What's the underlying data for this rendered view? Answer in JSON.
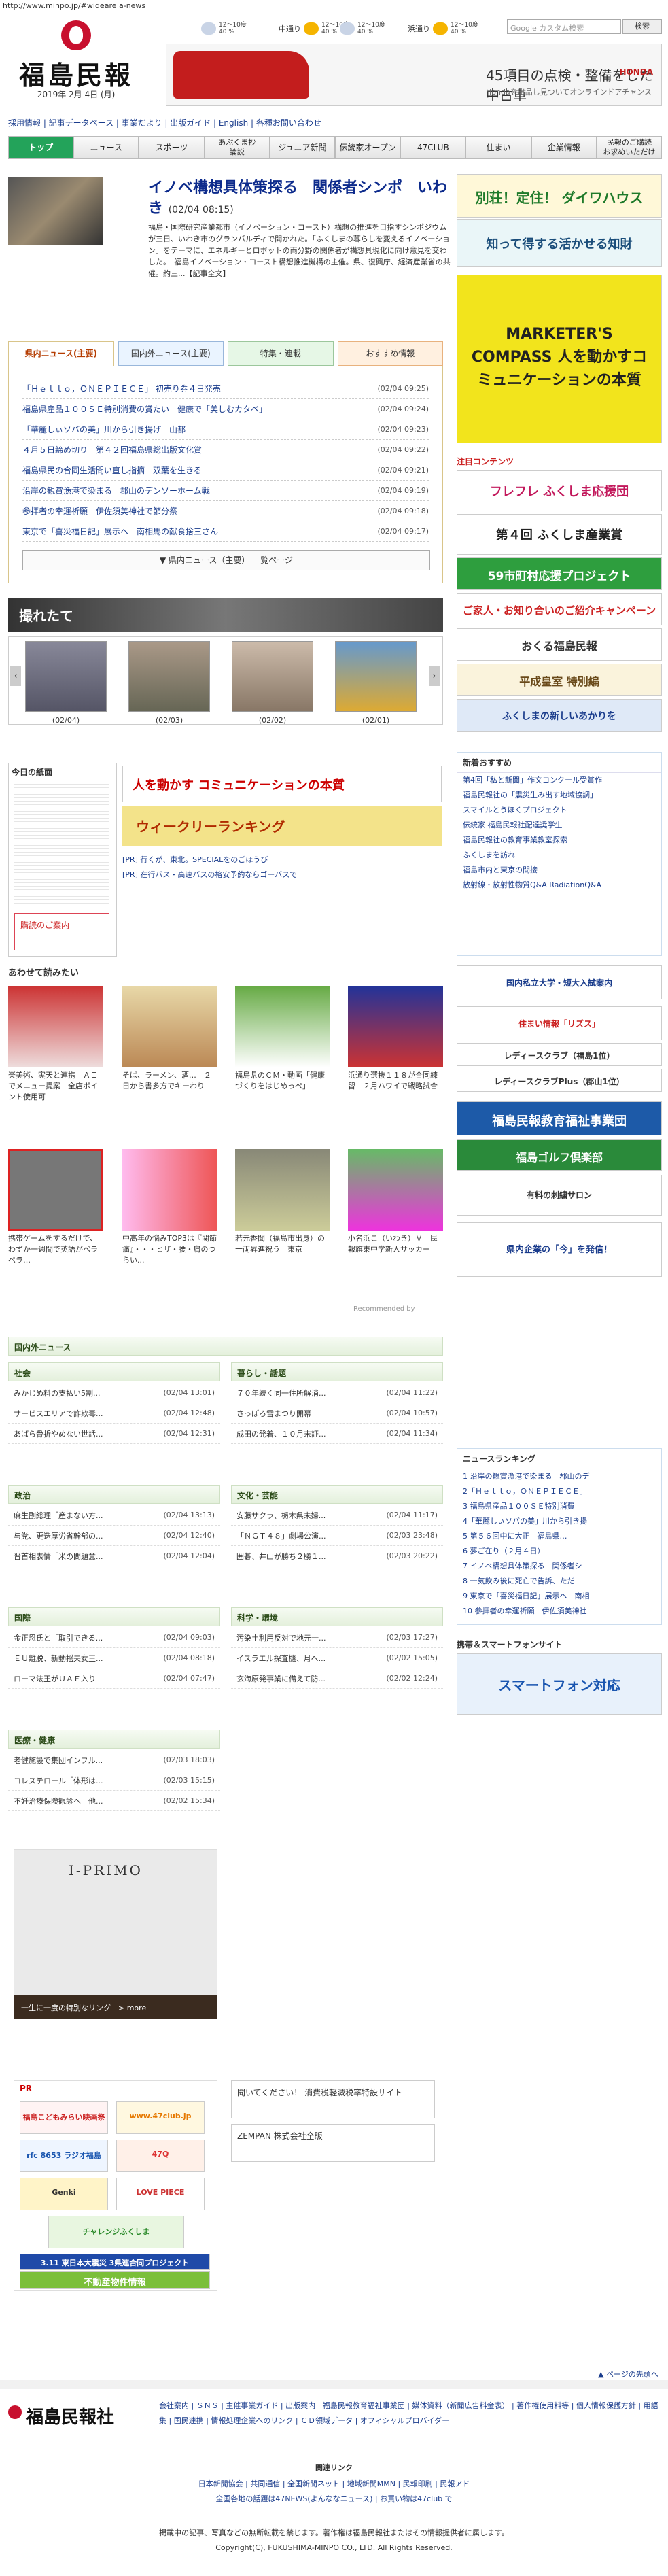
{
  "url": "http://www.minpo.jp/#wideare a-news",
  "logo": {
    "name": "福島民報",
    "date": "2019年 2月 4日 (月)"
  },
  "weather": [
    {
      "area": "",
      "temp": "12〜10度",
      "pct": "40 %"
    },
    {
      "area": "中通り",
      "temp": "12〜10度",
      "pct": "40 %"
    },
    {
      "area": "",
      "temp": "12〜10度",
      "pct": "40 %"
    },
    {
      "area": "浜通り",
      "temp": "12〜10度",
      "pct": "40 %"
    }
  ],
  "search": {
    "placeholder": "Google カスタム検索",
    "button": "検索"
  },
  "car_ad": {
    "headline": "45項目の点検・整備をした中古車",
    "sub": "Hondaを出品し見ついてオンラインドアチャンス",
    "brand": "HONDA"
  },
  "top_links": "採用情報 | 記事データベース | 事業だより | 出版ガイド | English | 各種お問い合わせ",
  "nav": [
    "トップ",
    "ニュース",
    "スポーツ",
    "あぶくま抄\n論説",
    "ジュニア新聞",
    "伝統家オープン",
    "47CLUB",
    "住まい",
    "企業情報",
    "民報のご購読\nお求めいただけ"
  ],
  "headline": {
    "title": "イノベ構想具体策探る　関係者シンポ　いわき",
    "date": "(02/04 08:15)",
    "body": "福島・国際研究産業都市（イノベーション・コースト）構想の推進を目指すシンポジウムが三日、いわき市のグランパルディで開かれた。「ふくしまの暮らしを変えるイノベーション」をテーマに、エネルギーとロボットの両分野の関係者が構想具現化に向け意見を交わした。　福島イノベーション・コースト構想推進機構の主催。県、復興庁、経済産業省の共催。約三...【記事全文】"
  },
  "tabs": [
    "県内ニュース(主要)",
    "国内外ニュース(主要)",
    "特集・連載",
    "おすすめ情報"
  ],
  "prefecture_news": [
    {
      "title": "「Ｈｅｌｌｏ，ＯＮＥＰＩＥＣＥ」 初売り券４日発売",
      "date": "(02/04 09:25)"
    },
    {
      "title": "福島県産品１００ＳＥ特別消費の賞たい　健康で「美しむカタベ」",
      "date": "(02/04 09:24)"
    },
    {
      "title": "「華麗しぃソバの美」川から引き揚げ　山都",
      "date": "(02/04 09:23)"
    },
    {
      "title": "４月５日締め切り　第４２回福島県総出版文化賞",
      "date": "(02/04 09:22)"
    },
    {
      "title": "福島県民の合同生活問い直し指摘　双葉を生きる",
      "date": "(02/04 09:21)"
    },
    {
      "title": "沿岸の観賞漁港で染まる　郡山のデンソーホーム戦",
      "date": "(02/04 09:19)"
    },
    {
      "title": "参拝者の幸運祈願　伊佐須美神社で節分祭",
      "date": "(02/04 09:18)"
    },
    {
      "title": "東京で「喜災福日記」展示へ　南相馬の献食捨三さん",
      "date": "(02/04 09:17)"
    }
  ],
  "more_label": "▼ 県内ニュース（主要） 一覧ページ",
  "photo": {
    "title": "撮れたて",
    "captions": [
      "(02/04)",
      "(02/03)",
      "(02/02)",
      "(02/01)"
    ]
  },
  "today_paper": {
    "title": "今日の紙面",
    "buy": "購読のご案内"
  },
  "mc_ad": "人を動かす コミュニケーションの本質",
  "rank_ad": "ウィークリーランキング",
  "pr_links": [
    "[PR] 行くが、東北。SPECIALをのごほうび",
    "[PR] 在行バス・高速バスの格安予約ならゴーバスで"
  ],
  "recommend_title": "あわせて読みたい",
  "recommend": [
    "楽美術、実天と連携　ＡＩでメニュー提案　全店ポイント使用可",
    "そば、ラーメン、酒…　２日から書多方でキーわり",
    "福島県のＣＭ・動画「健康づくりをはじめっぺ」",
    "浜通り選抜１１８が合同練習　２月ハワイで戦略試合",
    "携帯ゲームをするだけで、わずか一週間で英語がペラペラ…",
    "中高年の悩みTOP3は『関節痛』・・・ヒザ・腰・肩のつらい...",
    "若元香聞（福島市出身）の十両昇進祝う　東京",
    "小名浜こ（いわき）Ｖ　民報旗東中学新人サッカー"
  ],
  "recommend_by": "Recommended by",
  "domestic_head": "国内外ニュース",
  "sections": [
    {
      "name": "社会",
      "rows": [
        {
          "t": "みかじめ料の支払い5割...",
          "d": "(02/04 13:01)"
        },
        {
          "t": "サービスエリアで詐欺毒...",
          "d": "(02/04 12:48)"
        },
        {
          "t": "あばら骨折やめない世話...",
          "d": "(02/04 12:31)"
        }
      ]
    },
    {
      "name": "暮らし・話題",
      "rows": [
        {
          "t": "７０年続く同一住所解消...",
          "d": "(02/04 11:22)"
        },
        {
          "t": "さっぽろ雪まつり開幕",
          "d": "(02/04 10:57)"
        },
        {
          "t": "成田の発着、１０月末証...",
          "d": "(02/04 11:34)"
        }
      ]
    },
    {
      "name": "政治",
      "rows": [
        {
          "t": "麻生副総理「産まない方...",
          "d": "(02/04 13:13)"
        },
        {
          "t": "与党、更迭厚労省幹部の...",
          "d": "(02/04 12:40)"
        },
        {
          "t": "晋首相表情「米の問題意...",
          "d": "(02/04 12:04)"
        }
      ]
    },
    {
      "name": "文化・芸能",
      "rows": [
        {
          "t": "安藤サクラ、栃木県未婦...",
          "d": "(02/04 11:17)"
        },
        {
          "t": "「ＮＧＴ４８」劇場公演...",
          "d": "(02/03 23:48)"
        },
        {
          "t": "囲碁、井山が勝ち２勝１...",
          "d": "(02/03 20:22)"
        }
      ]
    },
    {
      "name": "国際",
      "rows": [
        {
          "t": "金正恩氏と「取引できる...",
          "d": "(02/04 09:03)"
        },
        {
          "t": "ＥＵ離脱、新動揺夫女王...",
          "d": "(02/04 08:18)"
        },
        {
          "t": "ローマ法王がＵＡＥ入り",
          "d": "(02/04 07:47)"
        }
      ]
    },
    {
      "name": "科学・環境",
      "rows": [
        {
          "t": "汚染土利用反対で地元一...",
          "d": "(02/03 17:27)"
        },
        {
          "t": "イスラエル探査機、月へ...",
          "d": "(02/02 15:05)"
        },
        {
          "t": "玄海原発事業に備えて防...",
          "d": "(02/02 12:24)"
        }
      ]
    },
    {
      "name": "医療・健康",
      "rows": [
        {
          "t": "老健施設で集団インフル...",
          "d": "(02/03 18:03)"
        },
        {
          "t": "コレステロール「体形は...",
          "d": "(02/03 15:15)"
        },
        {
          "t": "不妊治療保険観診へ　他...",
          "d": "(02/02 15:34)"
        }
      ]
    }
  ],
  "iprimo": {
    "brand": "I-PRIMO",
    "tagline": "一生に一度の特別なリング　> more"
  },
  "pr_box": {
    "title": "PR",
    "items": [
      "福島こどもみらい映画祭",
      "www.47club.jp",
      "rfc 8653 ラジオ福島",
      "47Q",
      "Genki",
      "LOVE PIECE",
      "チャレンジふくしま",
      "3.11 東日本大震災 3県連合同プロジェクト",
      "不動産物件情報"
    ]
  },
  "side_banners": [
    {
      "t": "聞いてください！ 消費税軽減税率特設サイト"
    },
    {
      "t": "ZEMPAN 株式会社全販"
    }
  ],
  "right": {
    "ad1": "別荘！定住！ ダイワハウス",
    "ad1b": "知って得する活かせる知財",
    "ad2": "MARKETER'S COMPASS 人を動かすコミュニケーションの本質",
    "contents_head": "注目コンテンツ",
    "banners": [
      "フレフレ ふくしま応援団",
      "第４回 ふくしま産業賞",
      "59市町村応援プロジェクト",
      "ご家人・お知り合いのご紹介キャンペーン",
      "おくる福島民報",
      "平成皇室 特別編",
      "ふくしまの新しいあかりを"
    ],
    "recs_head": "新着おすすめ",
    "recs": [
      "第4回「私と新聞」作文コンクール受賞作",
      "福島民報社の「震災生み出す地域協調」",
      "スマイルとうほくプロジェクト",
      "伝統家 福島民報社配達奨学生",
      "福島民報社の教育事業教室探索",
      "ふくしまを訪れ",
      "福島市内と東京の間接",
      "放射線・放射性物質Q&A RadiationQ&A"
    ],
    "univ": "国内私立大学・短大入試案内",
    "living": [
      "住まい情報「リズス」",
      "レディースクラブ（福島1位）",
      "レディースクラブPlus（郡山1位）"
    ],
    "edu": "福島民報教育福祉事業団",
    "golf": "福島ゴルフ倶楽部",
    "salon": "有料の刺繍サロン",
    "newsrelease": "県内企業の「今」を発信！",
    "ranking_head": "ニュースランキング",
    "ranking": [
      "1 沿岸の観賞漁港で染まる　郡山のデ",
      "2「Ｈｅｌｌｏ，ＯＮＥＰＩＥＣＥ」",
      "3 福島県産品１００ＳＥ特別消費",
      "4「華麗しぃソバの美」川から引き揚",
      "5 第５６回中に大正　福島県…",
      "6 夢ご在り（２月４日）",
      "7 イノベ構想具体策探る　関係者シ",
      "8 一気飲み後に死亡で告訴、ただ",
      "9 東京で「喜災福日記」展示へ　南相",
      "10 参拝者の幸運祈願　伊佐須美神社"
    ],
    "mobile_head": "携帯＆スマートフォンサイト",
    "mobile": "スマートフォン対応"
  },
  "footer": {
    "pagetop": "▲ ページの先頭へ",
    "logo": "福島民報社",
    "links": "会社案内 | ＳＮＳ | 主催事業ガイド | 出版案内 | 福島民報教育福祉事業団 | 媒体資料（新聞広告料金表） | 著作権使用料等 | 個人情報保護方針 | 用語集 | 国民連携 | 情報処理企業へのリンク | ＣＤ領域データ | オフィシャルプロバイダー",
    "related_head": "関連リンク",
    "related": "日本新聞協会 | 共同通信 | 全国新聞ネット | 地域新聞MMN | 民報印刷 | 民報アド",
    "related2": "全国各地の話題は47NEWS(よんななニュース) | お買い物は47club で",
    "copy1": "掲載中の記事、写真などの無断転載を禁じます。著作権は福島民報社またはその情報提供者に属します。",
    "copy2": "Copyright(C), FUKUSHIMA-MINPO CO., LTD. All Rights Reserved."
  }
}
